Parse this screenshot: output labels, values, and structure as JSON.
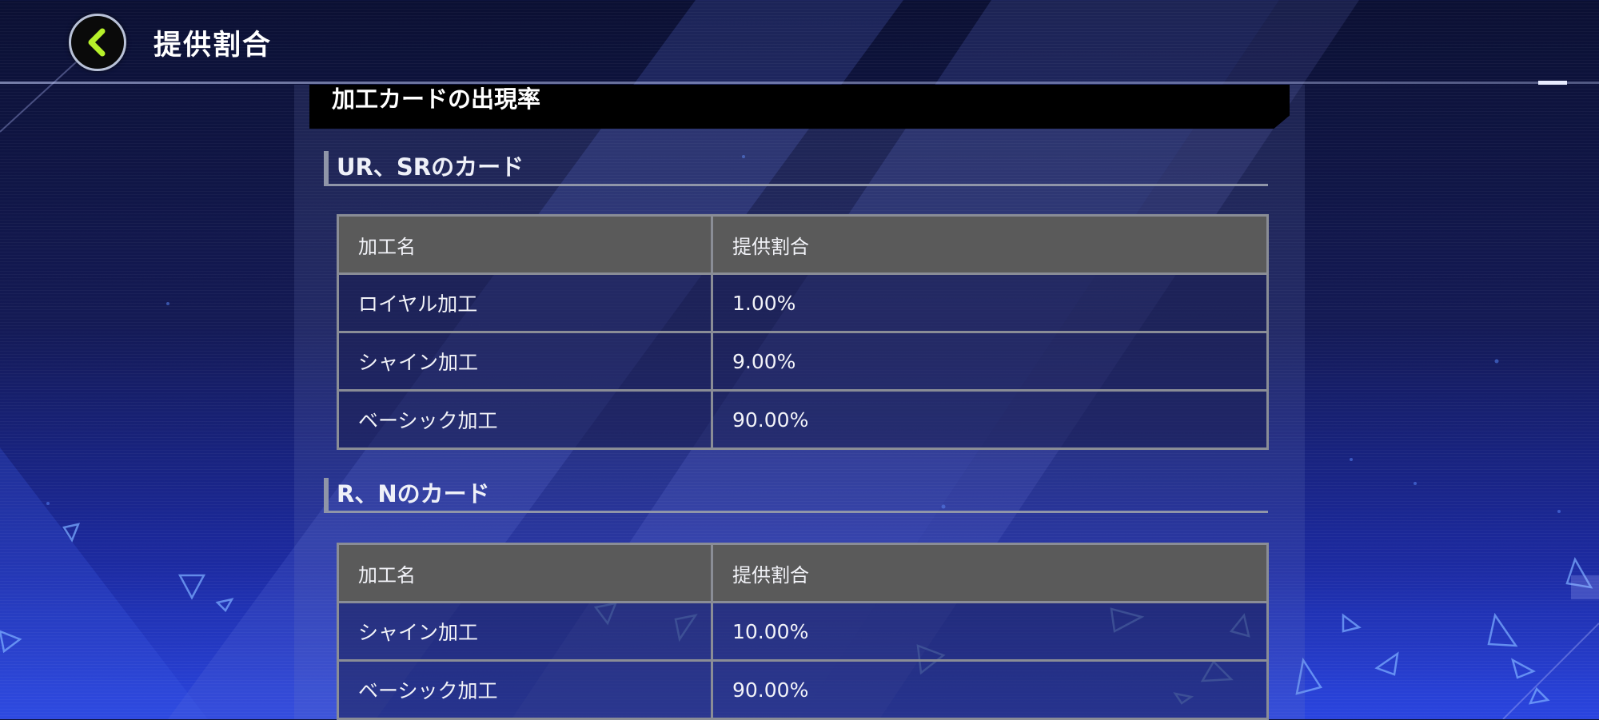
{
  "header": {
    "title": "提供割合",
    "back_icon": "chevron-left-icon",
    "accent_color": "#b6f02a"
  },
  "banner": {
    "title": "加工カードの出現率"
  },
  "sections": [
    {
      "heading": "UR、SRのカード",
      "table": {
        "headers": [
          "加工名",
          "提供割合"
        ],
        "rows": [
          {
            "name": "ロイヤル加工",
            "rate": "1.00%"
          },
          {
            "name": "シャイン加工",
            "rate": "9.00%"
          },
          {
            "name": "ベーシック加工",
            "rate": "90.00%"
          }
        ]
      }
    },
    {
      "heading": "R、Nのカード",
      "table": {
        "headers": [
          "加工名",
          "提供割合"
        ],
        "rows": [
          {
            "name": "シャイン加工",
            "rate": "10.00%"
          },
          {
            "name": "ベーシック加工",
            "rate": "90.00%"
          }
        ]
      }
    }
  ]
}
